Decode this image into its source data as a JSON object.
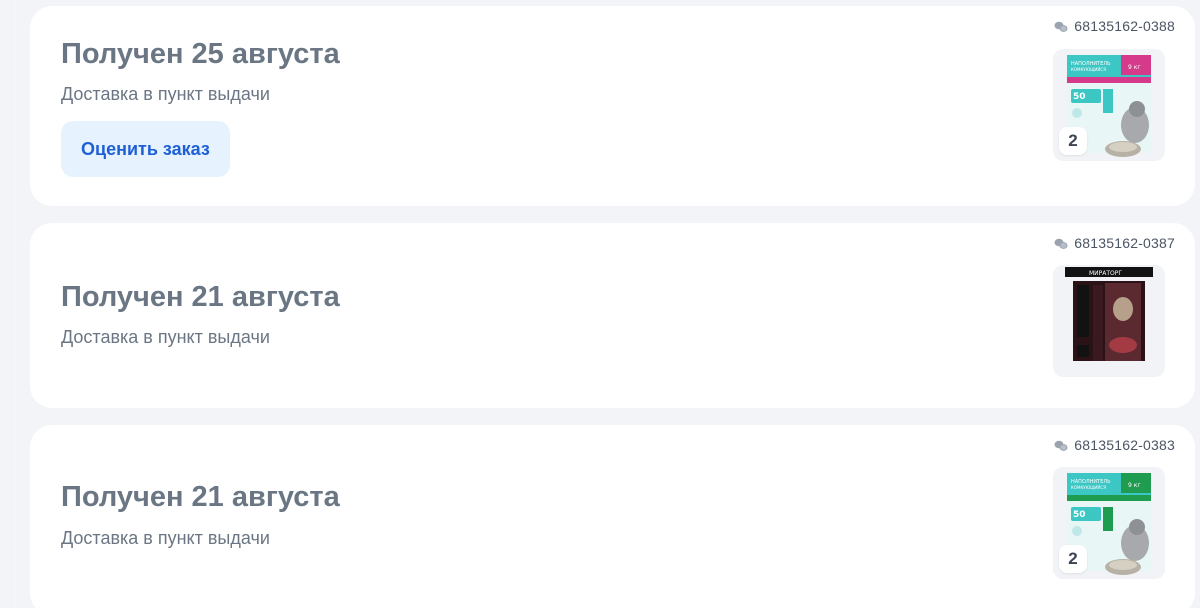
{
  "orders": [
    {
      "status_title": "Получен 25 августа",
      "delivery_method": "Доставка в пункт выдачи",
      "rate_button_label": "Оценить заказ",
      "order_number": "68135162-0388",
      "item_quantity": "2",
      "product_icon": "cat-litter-pink-package-icon",
      "accent_color": "#d63a8a"
    },
    {
      "status_title": "Получен 21 августа",
      "delivery_method": "Доставка в пункт выдачи",
      "order_number": "68135162-0387",
      "product_icon": "miratorg-pet-food-package-icon",
      "accent_color": "#2a1216"
    },
    {
      "status_title": "Получен 21 августа",
      "delivery_method": "Доставка в пункт выдачи",
      "order_number": "68135162-0383",
      "item_quantity": "2",
      "product_icon": "cat-litter-green-package-icon",
      "accent_color": "#1f9c4f"
    }
  ],
  "colors": {
    "title": "#6b7684",
    "button_bg": "#e6f3ff",
    "button_text": "#1f5fd6",
    "page_bg": "#f2f4f7"
  }
}
